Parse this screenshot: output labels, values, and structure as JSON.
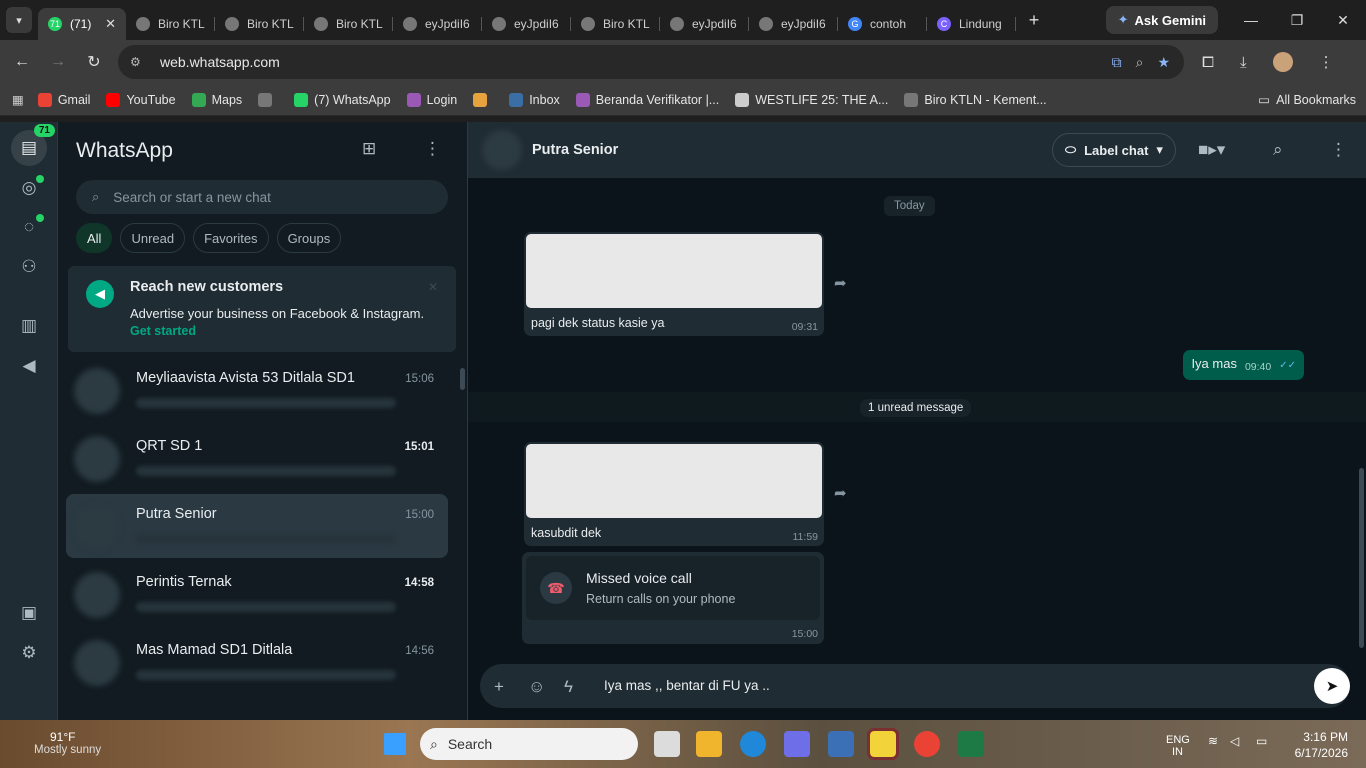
{
  "browser": {
    "tabs": [
      {
        "label": "(71)",
        "fav_color": "#25d366",
        "fav_text": "71",
        "active": true
      },
      {
        "label": "Biro KTL",
        "fav_color": "#777",
        "fav_text": ""
      },
      {
        "label": "Biro KTL",
        "fav_color": "#777",
        "fav_text": ""
      },
      {
        "label": "Biro KTL",
        "fav_color": "#777",
        "fav_text": ""
      },
      {
        "label": "eyJpdiI6",
        "fav_color": "#777",
        "fav_text": ""
      },
      {
        "label": "eyJpdiI6",
        "fav_color": "#777",
        "fav_text": ""
      },
      {
        "label": "Biro KTL",
        "fav_color": "#777",
        "fav_text": ""
      },
      {
        "label": "eyJpdiI6",
        "fav_color": "#777",
        "fav_text": ""
      },
      {
        "label": "eyJpdiI6",
        "fav_color": "#777",
        "fav_text": ""
      },
      {
        "label": "contoh",
        "fav_color": "#4285f4",
        "fav_text": "G"
      },
      {
        "label": "Lindung",
        "fav_color": "#7b61ff",
        "fav_text": "C"
      }
    ],
    "gemini_label": "Ask Gemini",
    "url": "web.whatsapp.com",
    "bookmarks": [
      {
        "label": "Gmail",
        "fav_color": "#ea4335"
      },
      {
        "label": "YouTube",
        "fav_color": "#ff0000"
      },
      {
        "label": "Maps",
        "fav_color": "#34a853"
      },
      {
        "label": "",
        "fav_color": "#777"
      },
      {
        "label": "(7) WhatsApp",
        "fav_color": "#25d366"
      },
      {
        "label": "Login",
        "fav_color": "#9b59b6"
      },
      {
        "label": "",
        "fav_color": "#e6a23c"
      },
      {
        "label": "Inbox",
        "fav_color": "#3a6ea5"
      },
      {
        "label": "Beranda Verifikator |...",
        "fav_color": "#9b59b6"
      },
      {
        "label": "WESTLIFE 25: THE A...",
        "fav_color": "#ccc"
      },
      {
        "label": "Biro KTLN - Kement...",
        "fav_color": "#777"
      }
    ],
    "all_bookmarks": "All Bookmarks"
  },
  "whatsapp": {
    "rail_badge": "71",
    "title": "WhatsApp",
    "search_placeholder": "Search or start a new chat",
    "filters": [
      "All",
      "Unread",
      "Favorites",
      "Groups"
    ],
    "promo": {
      "title": "Reach new customers",
      "text": "Advertise your business on Facebook & Instagram.",
      "cta": "Get started"
    },
    "chats": [
      {
        "name": "Meyliaavista Avista 53 Ditlala SD1",
        "time": "15:06",
        "bold": false,
        "active": false
      },
      {
        "name": "QRT SD 1",
        "time": "15:01",
        "bold": true,
        "active": false
      },
      {
        "name": "Putra Senior",
        "time": "15:00",
        "bold": false,
        "active": true
      },
      {
        "name": "Perintis Ternak",
        "time": "14:58",
        "bold": true,
        "active": false
      },
      {
        "name": "Mas Mamad SD1 Ditlala",
        "time": "14:56",
        "bold": false,
        "active": false
      }
    ],
    "chat": {
      "contact": "Putra Senior",
      "label_chat": "Label chat",
      "date_divider": "Today",
      "messages": [
        {
          "caption": "pagi dek status kasie ya",
          "time": "09:31"
        },
        {
          "caption": "kasubdit dek",
          "time": "11:59"
        }
      ],
      "outgoing": {
        "text": "Iya mas",
        "time": "09:40"
      },
      "unread_divider": "1 unread message",
      "missed_call": {
        "title": "Missed voice call",
        "subtitle": "Return calls on your phone",
        "time": "15:00"
      },
      "draft": "Iya mas ,, bentar di FU ya .."
    }
  },
  "taskbar": {
    "temperature": "91°F",
    "weather": "Mostly sunny",
    "search": "Search",
    "lang": "ENG",
    "lang2": "IN",
    "time": "3:16 PM",
    "date": "6/17/2026"
  }
}
